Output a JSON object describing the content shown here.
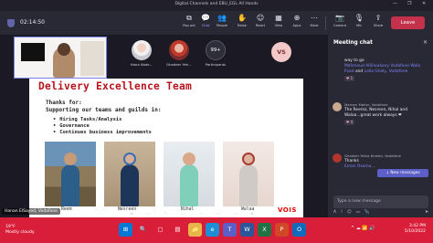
{
  "window": {
    "title": "Digital Channels and EBU_EGL All Hands",
    "controls": [
      "—",
      "❐",
      "✕"
    ]
  },
  "toolbar": {
    "timer": "02:14:50",
    "buttons": [
      {
        "label": "Pop out",
        "icon": "⧉"
      },
      {
        "label": "Chat",
        "icon": "💬",
        "active": true
      },
      {
        "label": "People",
        "icon": "👥"
      },
      {
        "label": "Raise",
        "icon": "✋"
      },
      {
        "label": "React",
        "icon": "☺"
      },
      {
        "label": "View",
        "icon": "▦"
      },
      {
        "label": "Apps",
        "icon": "⊕"
      },
      {
        "label": "More",
        "icon": "⋯"
      },
      {
        "label": "Camera",
        "icon": "📷"
      },
      {
        "label": "Mic",
        "icon": "🎙"
      },
      {
        "label": "Share",
        "icon": "⇪"
      }
    ],
    "leave_label": "Leave"
  },
  "participants": {
    "tiles": [
      {
        "name": "Hana Abde..."
      },
      {
        "name": "Ghadeer Yeh..."
      },
      {
        "name": "Participants",
        "count": "99+"
      }
    ],
    "vs_initials": "VS"
  },
  "slide": {
    "title": "Delivery Excellence Team",
    "thanks": "Thanks for:",
    "supporting": "Supporting our teams and guilds in:",
    "bullets": [
      "Hiring Tasks/Analysis",
      "Governance",
      "Continues business improvements"
    ],
    "captions": [
      "Reem",
      "Nesreen",
      "Nihal",
      "Walaa"
    ],
    "logo": "VOIS",
    "presenter": "Hanan ElSayed, Vodafone"
  },
  "chat": {
    "title": "Meeting chat",
    "messages": [
      {
        "meta": "",
        "lines": [
          "way to go"
        ],
        "links": [
          "Mahmoud AlShoukany",
          "Vodafone",
          "Wala Foad",
          "and",
          "Lalla Ghaly, Vodafone"
        ],
        "reaction": "❤ 1"
      },
      {
        "meta": "Mariam Maher, Vodafone",
        "lines": [
          "The Reemz, Nesreen, Nihal and Walaa...great work always ❤"
        ],
        "links": [],
        "reaction": "❤ 4"
      },
      {
        "meta": "Ghadeer Yehia Khaled, Vodafone",
        "lines": [
          "Thanks"
        ],
        "links": [
          "Eman Osama..."
        ],
        "reaction": ""
      }
    ],
    "new_messages": "↓ New messages",
    "input_placeholder": "Type a new message",
    "tools": [
      "A",
      "!",
      "☺",
      "▭",
      "📎",
      "➤"
    ]
  },
  "taskbar": {
    "weather_temp": "19°F",
    "weather_desc": "Mostly cloudy",
    "icons": [
      "⊞",
      "🔍",
      "▢",
      "▤",
      "📁",
      "e",
      "T",
      "W",
      "X",
      "P",
      "O"
    ],
    "tray": "^ ☁ 📶 🔊",
    "time": "3:42 PM",
    "date": "5/10/2022"
  },
  "colors": {
    "teams_purple": "#6264a7",
    "leave_red": "#c4314b",
    "slide_title_red": "#b8141d",
    "taskbar_red": "#d91e3a",
    "chat_bg": "#292835"
  }
}
